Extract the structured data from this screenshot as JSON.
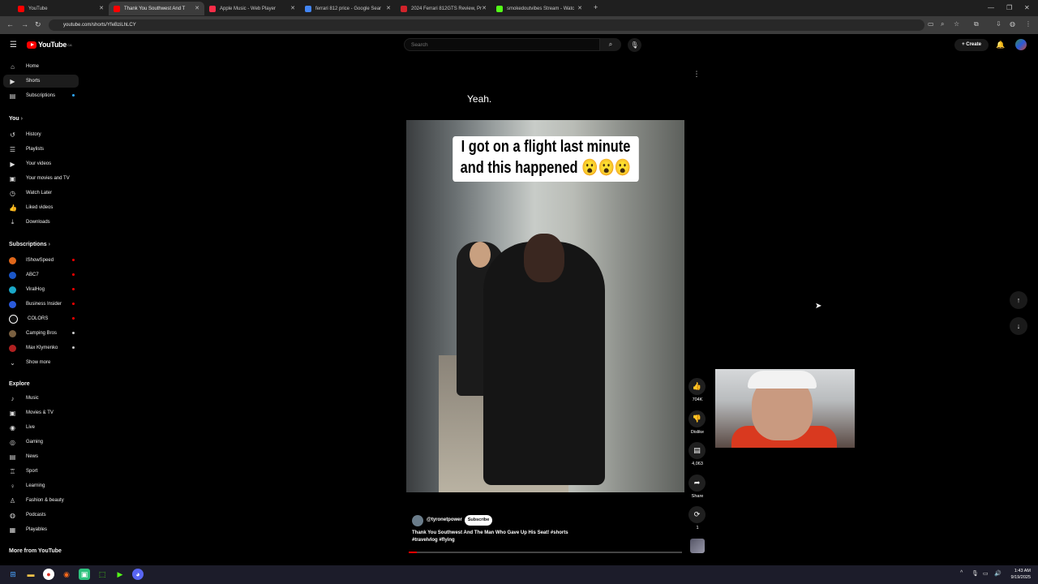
{
  "browser": {
    "tabs": [
      {
        "label": "YouTube",
        "color": "#ff0000"
      },
      {
        "label": "Thank You Southwest And T",
        "color": "#ff0000"
      },
      {
        "label": "Apple Music - Web Player",
        "color": "#fa2d48"
      },
      {
        "label": "ferrari 812 price - Google Sear",
        "color": "#4285f4"
      },
      {
        "label": "2024 Ferrari 812GTS Review, Pr",
        "color": "#d2232a"
      },
      {
        "label": "smokedoutvibes Stream - Watc",
        "color": "#53fc18"
      }
    ],
    "url": "youtube.com/shorts/YfeBziLhLCY"
  },
  "youtube": {
    "logo_text": "YouTube",
    "logo_region": "CA",
    "search_placeholder": "Search",
    "create_label": "Create"
  },
  "sidebar": {
    "main": [
      {
        "label": "Home",
        "icon": "⌂"
      },
      {
        "label": "Shorts",
        "icon": "▶"
      },
      {
        "label": "Subscriptions",
        "icon": "▤"
      }
    ],
    "you_header": "You",
    "you_items": [
      {
        "label": "History",
        "icon": "↺"
      },
      {
        "label": "Playlists",
        "icon": "☰"
      },
      {
        "label": "Your videos",
        "icon": "▶"
      },
      {
        "label": "Your movies and TV",
        "icon": "▣"
      },
      {
        "label": "Watch Later",
        "icon": "◷"
      },
      {
        "label": "Liked videos",
        "icon": "👍"
      },
      {
        "label": "Downloads",
        "icon": "⤓"
      }
    ],
    "subscriptions_header": "Subscriptions",
    "subscriptions": [
      {
        "label": "IShowSpeed",
        "color": "#e0671a",
        "dot": "#ff0000"
      },
      {
        "label": "ABC7",
        "color": "#1a56c8",
        "dot": "#ff0000"
      },
      {
        "label": "ViralHog",
        "color": "#1aa8c8",
        "dot": "#ff0000"
      },
      {
        "label": "Business Insider",
        "color": "#2a5adb",
        "dot": "#ff0000"
      },
      {
        "label": "COLORS",
        "color": "#111111",
        "dot": "#ff0000"
      },
      {
        "label": "Camping Bros",
        "color": "#7a6040",
        "dot": "#cccccc"
      },
      {
        "label": "Max Klymenko",
        "color": "#b02020",
        "dot": "#cccccc"
      }
    ],
    "show_more": "Show more",
    "explore_header": "Explore",
    "explore": [
      {
        "label": "Music",
        "icon": "♪"
      },
      {
        "label": "Movies & TV",
        "icon": "▣"
      },
      {
        "label": "Live",
        "icon": "◉"
      },
      {
        "label": "Gaming",
        "icon": "◎"
      },
      {
        "label": "News",
        "icon": "▤"
      },
      {
        "label": "Sport",
        "icon": "♖"
      },
      {
        "label": "Learning",
        "icon": "♀"
      },
      {
        "label": "Fashion & beauty",
        "icon": "♙"
      },
      {
        "label": "Podcasts",
        "icon": "◍"
      },
      {
        "label": "Playables",
        "icon": "▦"
      }
    ],
    "more_header": "More from YouTube"
  },
  "short": {
    "spoken_caption": "Yeah.",
    "overlay_line1": "I got on a flight last minute",
    "overlay_line2": "and this happened 😮😮😮",
    "channel": "@tyronetpower",
    "subscribe_label": "Subscribe",
    "title_line1": "Thank You Southwest And The Man Who Gave Up His Seat! #shorts",
    "title_line2": "#travelvlog #flying",
    "likes": "704K",
    "dislike_label": "Dislike",
    "comments": "4,063",
    "share_label": "Share",
    "remix_count": "1"
  },
  "taskbar": {
    "time": "1:43 AM",
    "date": "9/19/2025"
  }
}
